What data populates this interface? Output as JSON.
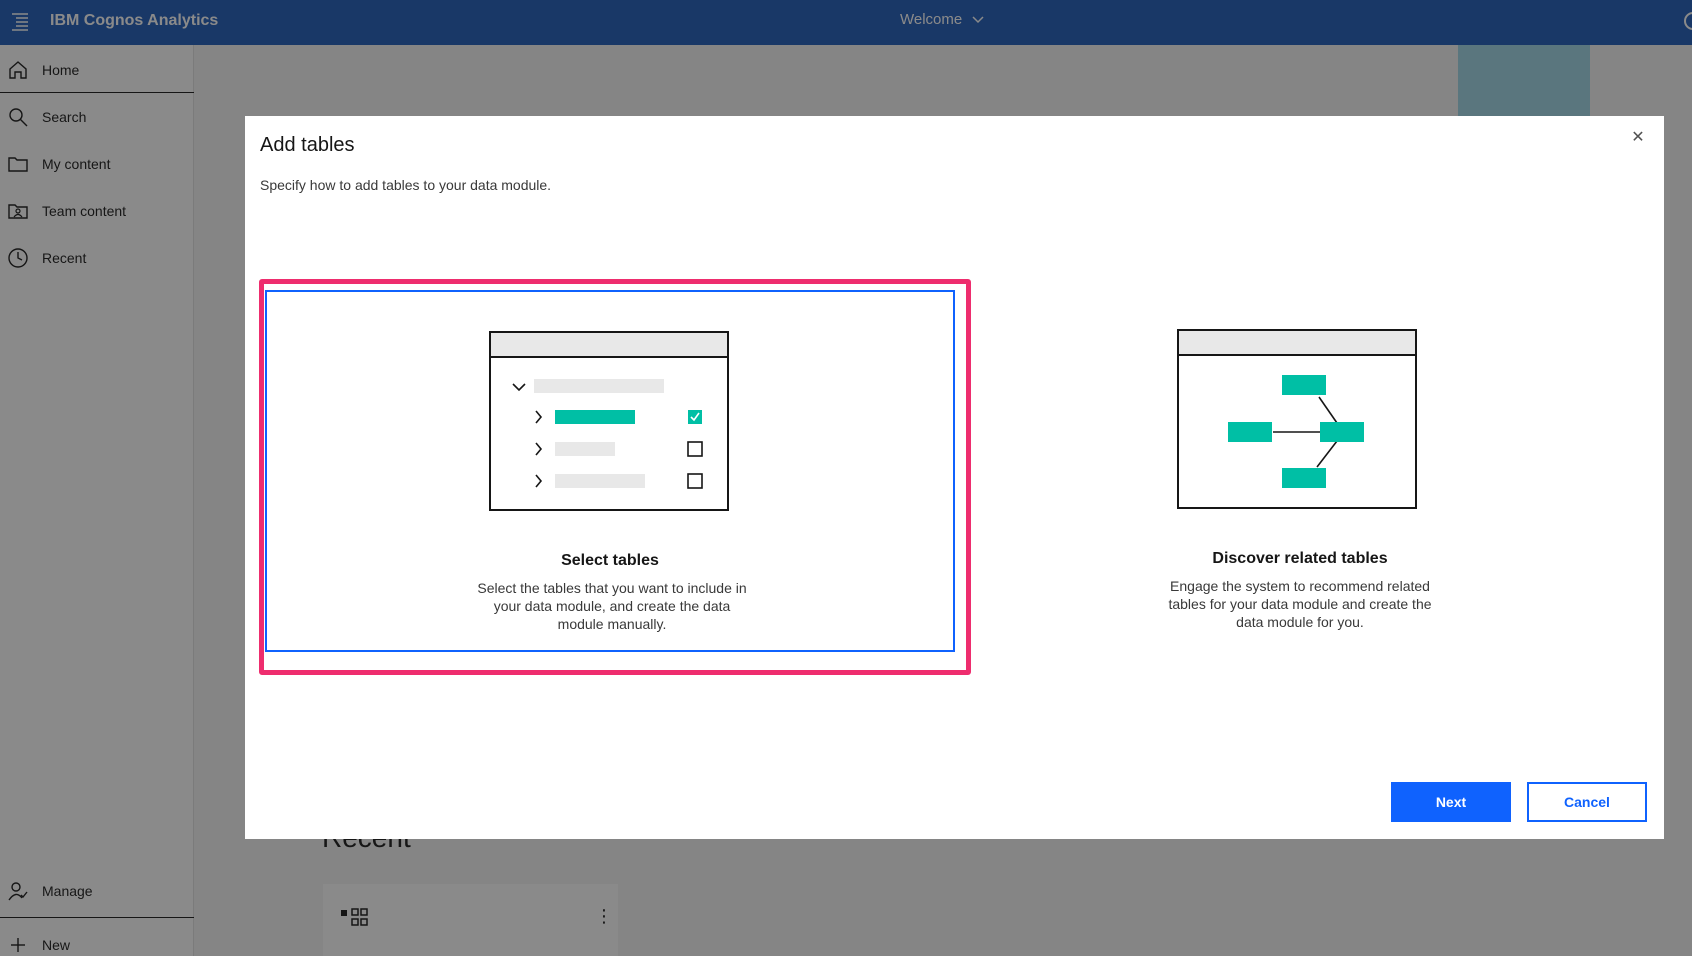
{
  "app": {
    "title": "IBM Cognos Analytics",
    "welcome_label": "Welcome"
  },
  "sidebar": {
    "items": [
      {
        "label": "Home",
        "icon": "home-icon"
      },
      {
        "label": "Search",
        "icon": "search-icon"
      },
      {
        "label": "My content",
        "icon": "folder-icon"
      },
      {
        "label": "Team content",
        "icon": "team-folder-icon"
      },
      {
        "label": "Recent",
        "icon": "clock-icon"
      }
    ],
    "bottom_items": [
      {
        "label": "Manage",
        "icon": "manage-user-icon"
      },
      {
        "label": "New",
        "icon": "plus-icon"
      }
    ]
  },
  "background": {
    "recent_title": "Recent"
  },
  "dialog": {
    "title": "Add tables",
    "description": "Specify how to add tables to your data module.",
    "close_icon": "close-icon",
    "options": [
      {
        "title": "Select tables",
        "text": "Select the tables that you want to include in your data module, and create the data module manually.",
        "selected": true
      },
      {
        "title": "Discover related tables",
        "text": "Engage the system to recommend related tables for your data module and create the data module for you.",
        "selected": false
      }
    ],
    "next_label": "Next",
    "cancel_label": "Cancel"
  },
  "colors": {
    "brand_bar": "#1d5ab8",
    "primary": "#0f62fe",
    "accent_teal": "#00bfa5",
    "highlight": "#ee2d6e"
  }
}
